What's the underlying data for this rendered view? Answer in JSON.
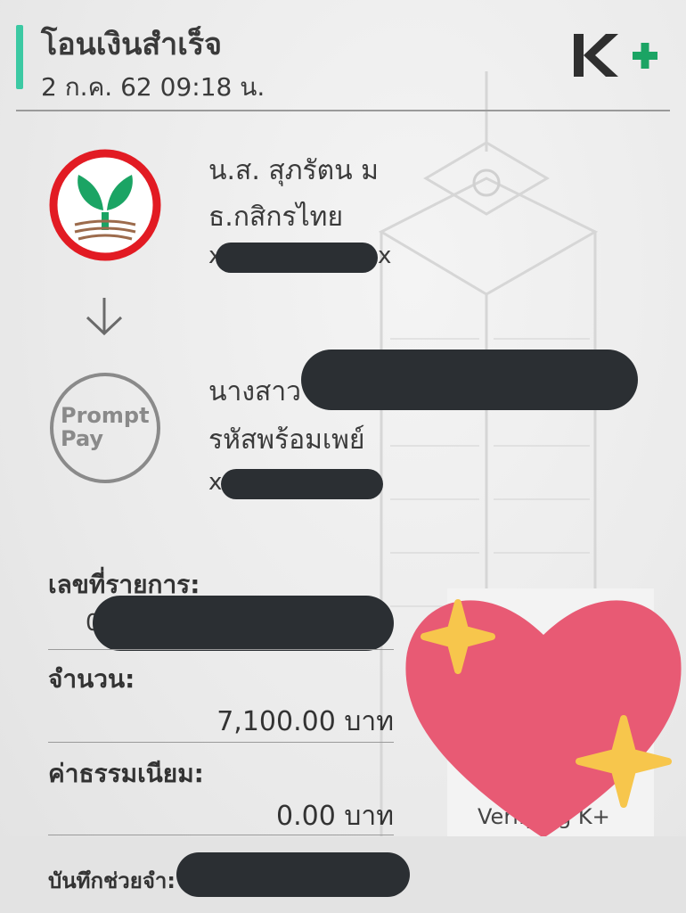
{
  "header": {
    "title": "โอนเงินสำเร็จ",
    "datetime": "2 ก.ค. 62  09:18 น.",
    "logo_text": "K+"
  },
  "sender": {
    "name": "น.ส. สุภรัตน ม",
    "bank": "ธ.กสิกรไทย",
    "account_prefix": "x",
    "account_suffix": "x"
  },
  "receiver": {
    "name_prefix": "นางสาว",
    "bank": "รหัสพร้อมเพย์",
    "account_prefix": "x",
    "logo_line1": "Prompt",
    "logo_line2": "Pay"
  },
  "transaction": {
    "ref_label": "เลขที่รายการ:",
    "ref_prefix": "0",
    "amount_label": "จำนวน:",
    "amount_value": "7,100.00 บาท",
    "fee_label": "ค่าธรรมเนียม:",
    "fee_value": "0.00 บาท"
  },
  "footer": {
    "memo_label": "บันทึกช่วยจำ:"
  },
  "qr": {
    "verify_text": "Verifying K+"
  },
  "colors": {
    "accent": "#3cc9a3",
    "kbank_green": "#1ba464",
    "kbank_red": "#e21b23",
    "kplus_green": "#1ba464",
    "heart": "#e85a74",
    "sparkle": "#f7c64c",
    "redaction": "#2b2f33"
  }
}
